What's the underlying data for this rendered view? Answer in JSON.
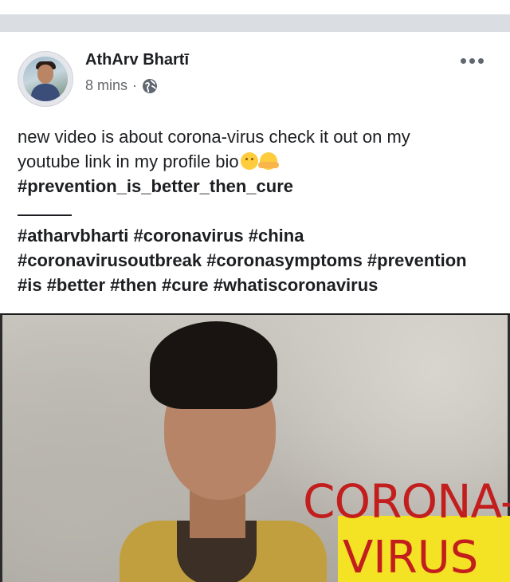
{
  "post": {
    "author": "AthArv Bhartī",
    "time": "8 mins",
    "meta_separator": "·",
    "privacy_icon": "globe-icon",
    "more_icon": "more-options-icon",
    "text_lines": [
      "new video is about corona-virus check it out on my",
      "youtube link in my profile bio"
    ],
    "emoji_icons": [
      "smiling-face-icon",
      "hugging-face-icon"
    ],
    "hashtag_primary": "#prevention_is_better_then_cure",
    "hashtag_lines": [
      "#atharvbharti #coronavirus #china",
      "#coronavirusoutbreak #coronasymptoms #prevention",
      "#is #better #then #cure #whatiscoronavirus"
    ]
  },
  "media": {
    "overlay_line1": "CORONA-",
    "overlay_line2": "VIRUS",
    "badge_color": "#f4e224",
    "text_color": "#c21e1e"
  },
  "colors": {
    "divider": "#dadde1",
    "meta_text": "#65676b",
    "primary_text": "#1c1e21"
  }
}
